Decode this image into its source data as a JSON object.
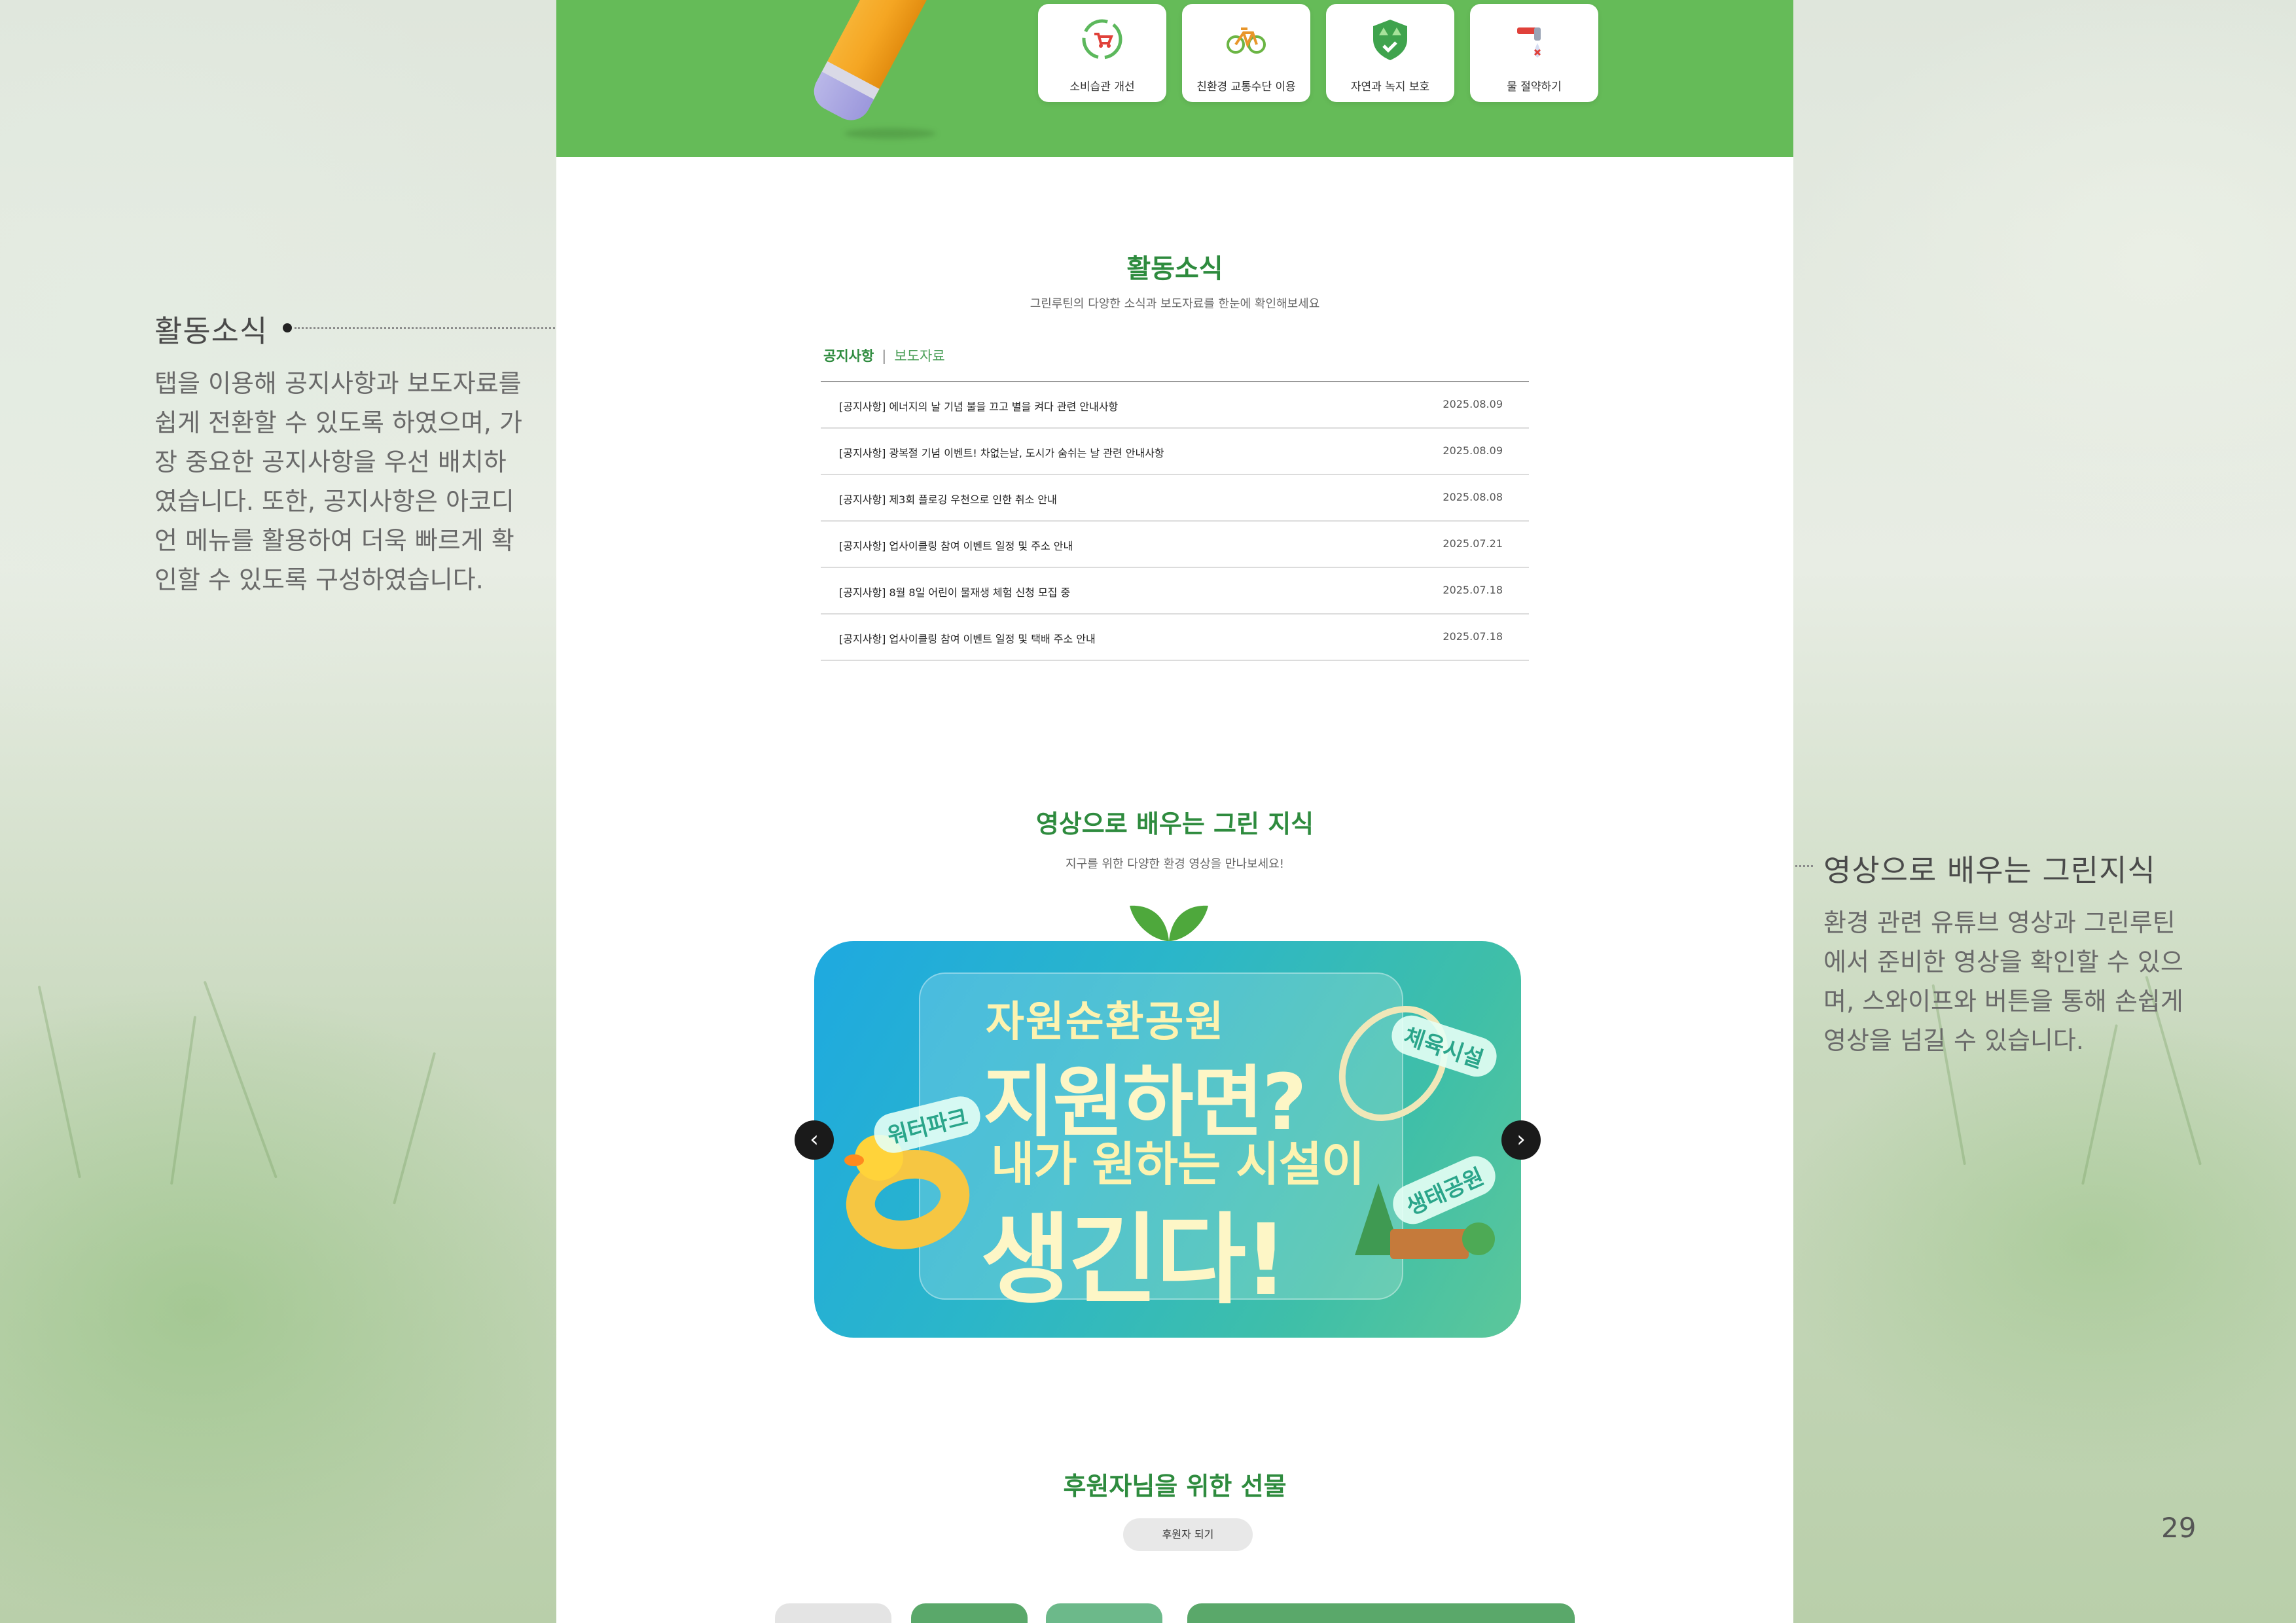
{
  "page_number": "29",
  "annotations": {
    "left": {
      "title": "활동소식",
      "body": [
        "탭을 이용해 공지사항과 보도자료를",
        "쉽게 전환할 수 있도록 하였으며, 가",
        "장 중요한 공지사항을 우선 배치하",
        "였습니다. 또한, 공지사항은 아코디",
        "언 메뉴를 활용하여 더욱 빠르게 확",
        "인할 수 있도록 구성하였습니다."
      ]
    },
    "right": {
      "title": "영상으로 배우는 그린지식",
      "body": [
        "환경 관련 유튜브 영상과 그린루틴",
        "에서 준비한 영상을 확인할 수 있으",
        "며, 스와이프와 버튼을 통해 손쉽게",
        "영상을 넘길 수 있습니다."
      ]
    }
  },
  "categories": [
    {
      "label": "소비습관 개선",
      "icon": "recycle-cart-icon"
    },
    {
      "label": "친환경 교통수단 이용",
      "icon": "bicycle-icon"
    },
    {
      "label": "자연과 녹지 보호",
      "icon": "tree-shield-icon"
    },
    {
      "label": "물 절약하기",
      "icon": "water-faucet-icon"
    }
  ],
  "news": {
    "title": "활동소식",
    "subtitle": "그린루틴의 다양한 소식과 보도자료를 한눈에 확인해보세요",
    "tabs": {
      "active": "공지사항",
      "separator": "|",
      "other": "보도자료"
    },
    "items": [
      {
        "title": "[공지사항] 에너지의 날 기념 불을 끄고 별을 켜다 관련 안내사항",
        "date": "2025.08.09"
      },
      {
        "title": "[공지사항] 광복절 기념 이벤트! 차없는날, 도시가 숨쉬는 날 관련 안내사항",
        "date": "2025.08.09"
      },
      {
        "title": "[공지사항] 제3회 플로깅 우천으로 인한 취소 안내",
        "date": "2025.08.08"
      },
      {
        "title": "[공지사항] 업사이클링 참여 이벤트 일정 및 주소 안내",
        "date": "2025.07.21"
      },
      {
        "title": "[공지사항] 8월 8일 어린이 물재생 체험 신청 모집 중",
        "date": "2025.07.18"
      },
      {
        "title": "[공지사항] 업사이클링 참여 이벤트 일정 및 택배 주소 안내",
        "date": "2025.07.18"
      }
    ]
  },
  "video": {
    "title": "영상으로 배우는 그린 지식",
    "subtitle": "지구를 위한 다양한 환경 영상을 만나보세요!",
    "banner": {
      "line1": "자원순환공원",
      "line2": "지원하면?",
      "line3": "내가 원하는 시설이",
      "line4": "생긴다!",
      "tag_water": "워터파크",
      "tag_sports": "체육시설",
      "tag_eco": "생태공원"
    },
    "prev_symbol": "‹",
    "next_symbol": "›"
  },
  "sponsor": {
    "title": "후원자님을 위한 선물",
    "button": "후원자 되기"
  },
  "colors": {
    "brand_green": "#65bb58",
    "title_green": "#2e8b3e"
  }
}
